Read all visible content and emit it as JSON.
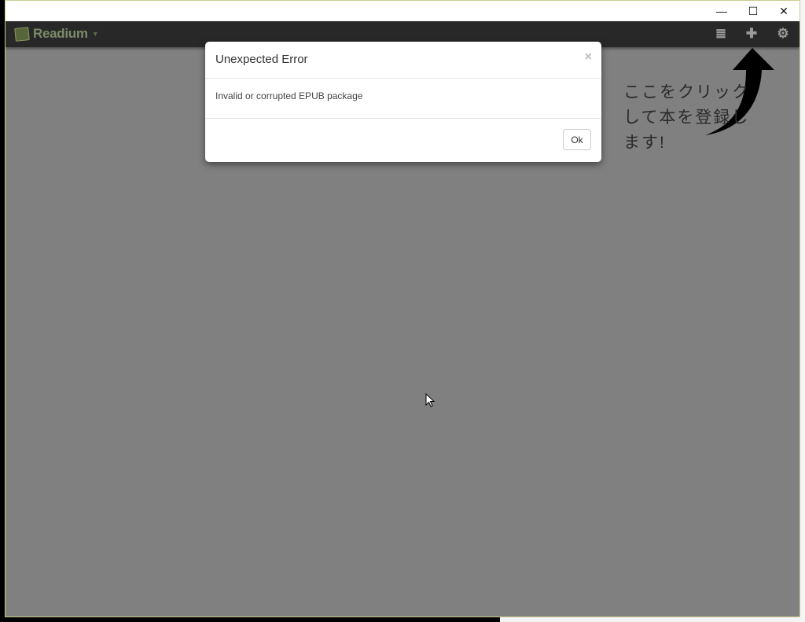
{
  "window": {
    "controls": {
      "minimize": "—",
      "maximize": "☐",
      "close": "✕"
    }
  },
  "navbar": {
    "brand": "Readium",
    "icons": [
      "list-view-icon",
      "add-book-icon",
      "settings-gear-icon"
    ]
  },
  "hint": {
    "text": "ここをクリックして本を登録します!"
  },
  "modal": {
    "title": "Unexpected Error",
    "close_label": "×",
    "message": "Invalid or corrupted EPUB package",
    "ok_label": "Ok"
  },
  "colors": {
    "navbar": "#282828",
    "content_background": "#808080",
    "brand": "#7d8a6a"
  }
}
